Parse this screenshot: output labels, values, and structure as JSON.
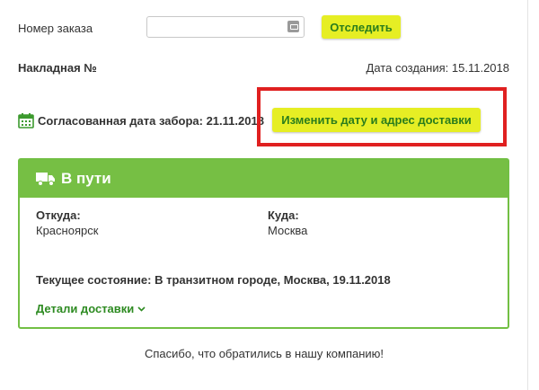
{
  "search": {
    "label": "Номер заказа",
    "value": "",
    "placeholder": "",
    "track_button": "Отследить"
  },
  "waybill": {
    "label": "Накладная №",
    "created_label": "Дата создания:",
    "created_date": "15.11.2018"
  },
  "pickup": {
    "label": "Согласованная дата забора:",
    "date": "21.11.2018",
    "change_button": "Изменить дату и адрес доставки"
  },
  "status": {
    "title": "В пути",
    "from_label": "Откуда:",
    "from_value": "Красноярск",
    "to_label": "Куда:",
    "to_value": "Москва",
    "current_label": "Текущее состояние:",
    "current_value": "В транзитном городе, Москва, 19.11.2018",
    "details_link": "Детали доставки"
  },
  "footer": {
    "thanks": "Спасибо, что обратились в нашу компанию!"
  },
  "icons": {
    "calendar": "calendar-icon",
    "truck": "truck-icon",
    "chevron": "chevron-down-icon",
    "input_addon": "password-manager-icon"
  },
  "colors": {
    "accent_green": "#76bf44",
    "button_yellow": "#e6ee24",
    "button_text": "#2a7d1c",
    "highlight_red": "#e02020",
    "link_green": "#2e8b22"
  }
}
